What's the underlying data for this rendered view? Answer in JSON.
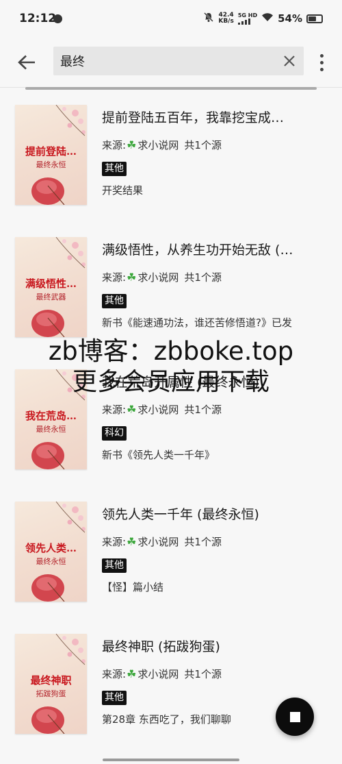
{
  "status_bar": {
    "time": "12:12",
    "net_speed_value": "42.4",
    "net_speed_unit": "KB/s",
    "signal_label": "5G HD",
    "battery_text": "54%",
    "battery_level": 0.54,
    "icons": [
      "timer-icon",
      "mute-icon",
      "signal-icon",
      "wifi-icon",
      "battery-icon"
    ]
  },
  "search": {
    "query": "最终",
    "icons": {
      "back": "arrow-left-icon",
      "clear": "close-icon",
      "more": "more-vert-icon"
    }
  },
  "books": [
    {
      "title": "提前登陆五百年，我靠挖宝成…",
      "cover_title": "提前登陆…",
      "cover_author": "最终永恒",
      "source_label": "来源:",
      "source_name": "求小说网",
      "source_count": "共1个源",
      "tag": "其他",
      "latest": "开奖结果"
    },
    {
      "title": "满级悟性，从养生功开始无敌 (…",
      "cover_title": "满级悟性…",
      "cover_author": "最终武器",
      "source_label": "来源:",
      "source_name": "求小说网",
      "source_count": "共1个源",
      "tag": "其他",
      "latest": "新书《能速通功法，谁还苦修悟道?》已发"
    },
    {
      "title": "我在荒岛开属性 (最终永恒)",
      "cover_title": "我在荒岛…",
      "cover_author": "最终永恒",
      "source_label": "来源:",
      "source_name": "求小说网",
      "source_count": "共1个源",
      "tag": "科幻",
      "latest": "新书《领先人类一千年》"
    },
    {
      "title": "领先人类一千年 (最终永恒)",
      "cover_title": "领先人类…",
      "cover_author": "最终永恒",
      "source_label": "来源:",
      "source_name": "求小说网",
      "source_count": "共1个源",
      "tag": "其他",
      "latest": "【怪】篇小结"
    },
    {
      "title": "最终神职 (拓跋狗蛋)",
      "cover_title": "最终神职",
      "cover_author": "拓跋狗蛋",
      "source_label": "来源:",
      "source_name": "求小说网",
      "source_count": "共1个源",
      "tag": "其他",
      "latest": "第28章 东西吃了，我们聊聊"
    }
  ],
  "watermark": {
    "line1": "zb博客：zbboke.top",
    "line2": "更多会员应用下载"
  },
  "fab": {
    "icon": "stop-icon"
  },
  "colors": {
    "background": "#f7f7f7",
    "search_box": "#e6e6e6",
    "tag_background": "#111111",
    "cover_title": "#c8161d",
    "clover": "#3aa63a"
  }
}
